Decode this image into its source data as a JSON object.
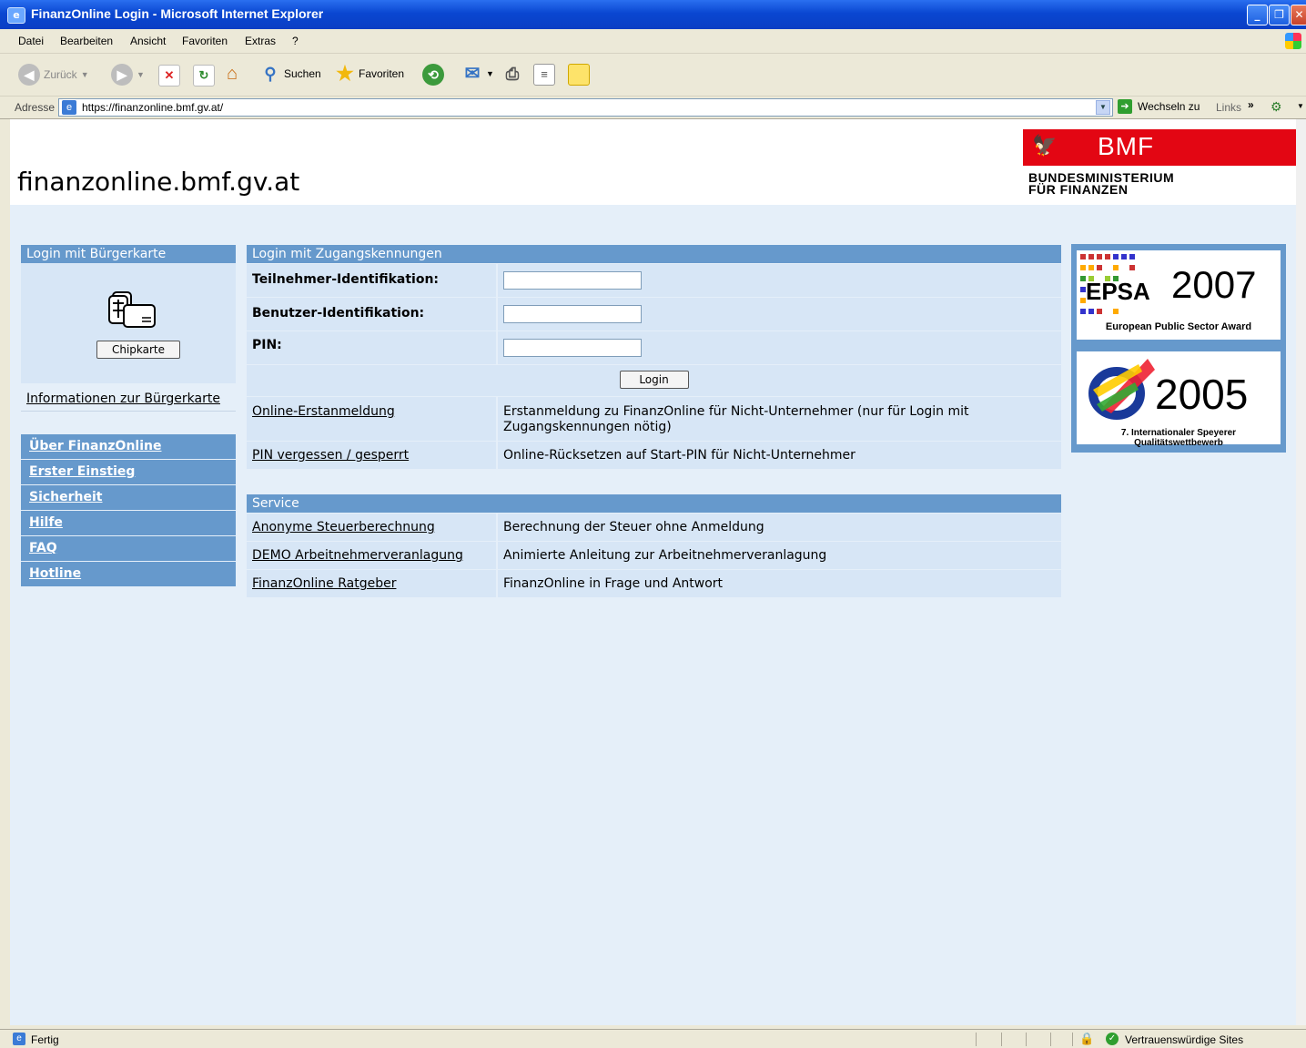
{
  "window": {
    "title": "FinanzOnline Login - Microsoft Internet Explorer"
  },
  "menu": [
    "Datei",
    "Bearbeiten",
    "Ansicht",
    "Favoriten",
    "Extras",
    "?"
  ],
  "toolbar": {
    "back_label": "Zurück",
    "search_label": "Suchen",
    "favorites_label": "Favoriten"
  },
  "address": {
    "label": "Adresse",
    "url": "https://finanzonline.bmf.gv.at/",
    "go_label": "Wechseln zu",
    "links_label": "Links"
  },
  "page": {
    "site_title": "finanzonline.bmf.gv.at",
    "bmf_logo_text": "BMF",
    "bmf_subtitle_line1": "BUNDESMINISTERIUM",
    "bmf_subtitle_line2": "FÜR FINANZEN"
  },
  "citizen_card": {
    "heading": "Login mit Bürgerkarte",
    "button_label": "Chipkarte",
    "info_link": "Informationen zur Bürgerkarte"
  },
  "sidebar_nav": [
    "Über FinanzOnline",
    "Erster Einstieg",
    "Sicherheit",
    "Hilfe",
    "FAQ",
    "Hotline"
  ],
  "login": {
    "heading": "Login mit Zugangskennungen",
    "fields": [
      {
        "label": "Teilnehmer-Identifikation:",
        "value": ""
      },
      {
        "label": "Benutzer-Identifikation:",
        "value": ""
      },
      {
        "label": "PIN:",
        "value": ""
      }
    ],
    "button_label": "Login",
    "links": [
      {
        "label": "Online-Erstanmeldung",
        "description": "Erstanmeldung zu FinanzOnline für Nicht-Unternehmer (nur für Login mit Zugangskennungen nötig)"
      },
      {
        "label": "PIN vergessen / gesperrt",
        "description": "Online-Rücksetzen auf Start-PIN für Nicht-Unternehmer"
      }
    ]
  },
  "service": {
    "heading": "Service",
    "items": [
      {
        "label": "Anonyme Steuerberechnung",
        "description": "Berechnung der Steuer ohne Anmeldung"
      },
      {
        "label": "DEMO Arbeitnehmerveranlagung",
        "description": "Animierte Anleitung zur Arbeitnehmerveranlagung"
      },
      {
        "label": "FinanzOnline Ratgeber",
        "description": "FinanzOnline in Frage und Antwort"
      }
    ]
  },
  "awards": {
    "epsa_year": "2007",
    "epsa_logo_text": "EPSA",
    "epsa_caption": "European Public Sector Award",
    "speyer_year": "2005",
    "speyer_caption": "7. Internationaler Speyerer Qualitätswettbewerb"
  },
  "status": {
    "left_text": "Fertig",
    "zone_text": "Vertrauenswürdige Sites"
  },
  "colors": {
    "nav_blue": "#6699cc",
    "panel_light": "#d7e6f6",
    "page_bg": "#e5eff9",
    "bmf_red": "#e30613"
  }
}
